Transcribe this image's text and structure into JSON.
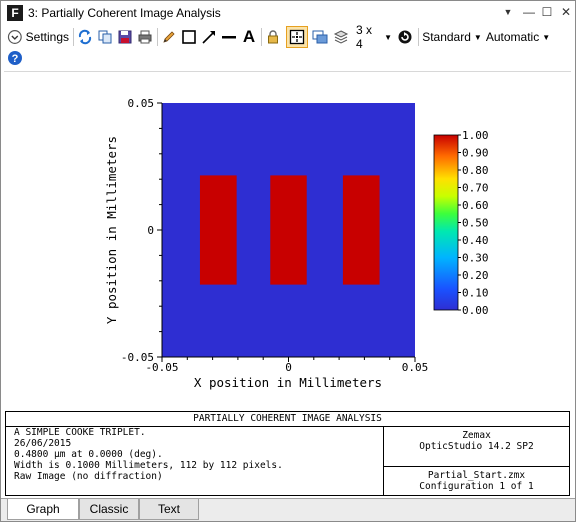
{
  "window": {
    "title": "3: Partially Coherent Image Analysis",
    "logo_letter": "F",
    "controls": {
      "pin": "▼",
      "minimize": "—",
      "maximize": "☐",
      "close": "✕"
    }
  },
  "toolbar": {
    "settings_label": "Settings",
    "layout_label": "3 x 4",
    "standard_label": "Standard",
    "automatic_label": "Automatic",
    "text_tool_label": "A"
  },
  "chart_data": {
    "type": "heatmap",
    "title": "",
    "xlabel": "X position in Millimeters",
    "ylabel": "Y position in Millimeters",
    "xlim": [
      -0.05,
      0.05
    ],
    "ylim": [
      -0.05,
      0.05
    ],
    "x_ticks": [
      "-0.05",
      "0",
      "0.05"
    ],
    "y_ticks": [
      "0.05",
      "0",
      "-0.05"
    ],
    "background_value": 0.0,
    "rectangles": [
      {
        "x0": -0.035,
        "x1": -0.0205,
        "y0": -0.0215,
        "y1": 0.0215,
        "value": 1.0
      },
      {
        "x0": -0.0072,
        "x1": 0.0072,
        "y0": -0.0215,
        "y1": 0.0215,
        "value": 1.0
      },
      {
        "x0": 0.0215,
        "x1": 0.036,
        "y0": -0.0215,
        "y1": 0.0215,
        "value": 1.0
      }
    ],
    "colorbar": {
      "ticks": [
        "1.00",
        "0.90",
        "0.80",
        "0.70",
        "0.60",
        "0.50",
        "0.40",
        "0.30",
        "0.20",
        "0.10",
        "0.00"
      ],
      "range": [
        0.0,
        1.0
      ]
    },
    "colors": {
      "low": "#2e2ed2",
      "high": "#c80000"
    },
    "grid": false
  },
  "info": {
    "title": "PARTIALLY COHERENT IMAGE ANALYSIS",
    "left_lines": [
      "A SIMPLE COOKE TRIPLET.",
      "26/06/2015",
      "0.4800 µm at 0.0000 (deg).",
      "Width is 0.1000 Millimeters, 112 by 112 pixels.",
      "Raw Image (no diffraction)"
    ],
    "right_top_lines": [
      "Zemax",
      "OpticStudio 14.2 SP2"
    ],
    "right_bottom_lines": [
      "Partial_Start.zmx",
      "Configuration 1 of 1"
    ]
  },
  "tabs": [
    {
      "label": "Graph",
      "active": true
    },
    {
      "label": "Classic",
      "active": false
    },
    {
      "label": "Text",
      "active": false
    }
  ]
}
